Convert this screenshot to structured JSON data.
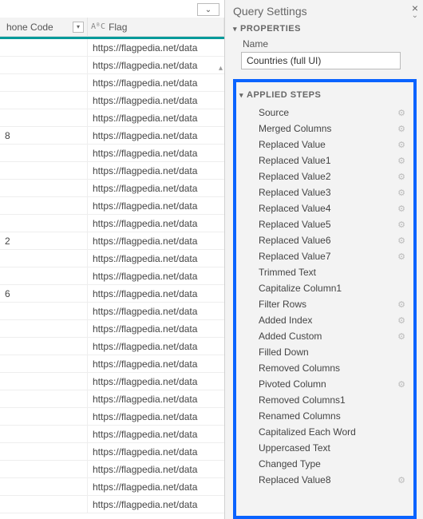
{
  "columns": {
    "phone": {
      "label": "hone Code",
      "type_icon": ""
    },
    "flag": {
      "label": "Flag",
      "type_icon": "AᴮC"
    }
  },
  "rows": [
    {
      "phone": "",
      "url": "https://flagpedia.net/data"
    },
    {
      "phone": "",
      "url": "https://flagpedia.net/data"
    },
    {
      "phone": "",
      "url": "https://flagpedia.net/data"
    },
    {
      "phone": "",
      "url": "https://flagpedia.net/data"
    },
    {
      "phone": "",
      "url": "https://flagpedia.net/data"
    },
    {
      "phone": "8",
      "url": "https://flagpedia.net/data"
    },
    {
      "phone": "",
      "url": "https://flagpedia.net/data"
    },
    {
      "phone": "",
      "url": "https://flagpedia.net/data"
    },
    {
      "phone": "",
      "url": "https://flagpedia.net/data"
    },
    {
      "phone": "",
      "url": "https://flagpedia.net/data"
    },
    {
      "phone": "",
      "url": "https://flagpedia.net/data"
    },
    {
      "phone": "2",
      "url": "https://flagpedia.net/data"
    },
    {
      "phone": "",
      "url": "https://flagpedia.net/data"
    },
    {
      "phone": "",
      "url": "https://flagpedia.net/data"
    },
    {
      "phone": "6",
      "url": "https://flagpedia.net/data"
    },
    {
      "phone": "",
      "url": "https://flagpedia.net/data"
    },
    {
      "phone": "",
      "url": "https://flagpedia.net/data"
    },
    {
      "phone": "",
      "url": "https://flagpedia.net/data"
    },
    {
      "phone": "",
      "url": "https://flagpedia.net/data"
    },
    {
      "phone": "",
      "url": "https://flagpedia.net/data"
    },
    {
      "phone": "",
      "url": "https://flagpedia.net/data"
    },
    {
      "phone": "",
      "url": "https://flagpedia.net/data"
    },
    {
      "phone": "",
      "url": "https://flagpedia.net/data"
    },
    {
      "phone": "",
      "url": "https://flagpedia.net/data"
    },
    {
      "phone": "",
      "url": "https://flagpedia.net/data"
    },
    {
      "phone": "",
      "url": "https://flagpedia.net/data"
    },
    {
      "phone": "",
      "url": "https://flagpedia.net/data"
    }
  ],
  "settings": {
    "title": "Query Settings",
    "properties_label": "PROPERTIES",
    "name_label": "Name",
    "name_value": "Countries (full UI)",
    "applied_steps_label": "APPLIED STEPS",
    "steps": [
      {
        "label": "Source",
        "gear": true
      },
      {
        "label": "Merged Columns",
        "gear": true
      },
      {
        "label": "Replaced Value",
        "gear": true
      },
      {
        "label": "Replaced Value1",
        "gear": true
      },
      {
        "label": "Replaced Value2",
        "gear": true
      },
      {
        "label": "Replaced Value3",
        "gear": true
      },
      {
        "label": "Replaced Value4",
        "gear": true
      },
      {
        "label": "Replaced Value5",
        "gear": true
      },
      {
        "label": "Replaced Value6",
        "gear": true
      },
      {
        "label": "Replaced Value7",
        "gear": true
      },
      {
        "label": "Trimmed Text",
        "gear": false
      },
      {
        "label": "Capitalize Column1",
        "gear": false
      },
      {
        "label": "Filter Rows",
        "gear": true
      },
      {
        "label": "Added Index",
        "gear": true
      },
      {
        "label": "Added Custom",
        "gear": true
      },
      {
        "label": "Filled Down",
        "gear": false
      },
      {
        "label": "Removed Columns",
        "gear": false
      },
      {
        "label": "Pivoted Column",
        "gear": true
      },
      {
        "label": "Removed Columns1",
        "gear": false
      },
      {
        "label": "Renamed Columns",
        "gear": false
      },
      {
        "label": "Capitalized Each Word",
        "gear": false
      },
      {
        "label": "Uppercased Text",
        "gear": false
      },
      {
        "label": "Changed Type",
        "gear": false
      },
      {
        "label": "Replaced Value8",
        "gear": true
      }
    ]
  }
}
